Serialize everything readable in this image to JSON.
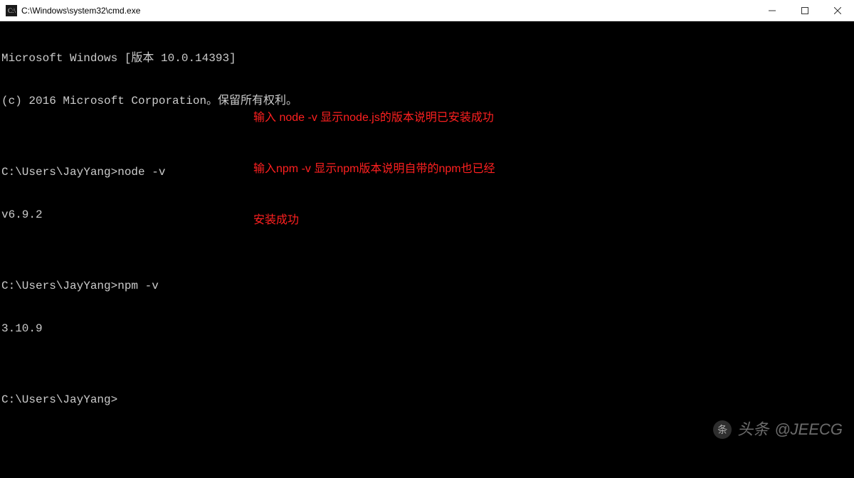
{
  "window": {
    "title": "C:\\Windows\\system32\\cmd.exe"
  },
  "terminal": {
    "lines": [
      "Microsoft Windows [版本 10.0.14393]",
      "(c) 2016 Microsoft Corporation。保留所有权利。",
      "",
      "C:\\Users\\JayYang>node -v",
      "v6.9.2",
      "",
      "C:\\Users\\JayYang>npm -v",
      "3.10.9",
      "",
      "C:\\Users\\JayYang>"
    ]
  },
  "annotation": {
    "line1": "输入 node -v 显示node.js的版本说明已安装成功",
    "line2": "输入npm -v 显示npm版本说明自带的npm也已经",
    "line3": "安装成功"
  },
  "watermark": {
    "prefix": "头条",
    "handle": "@JEECG"
  }
}
